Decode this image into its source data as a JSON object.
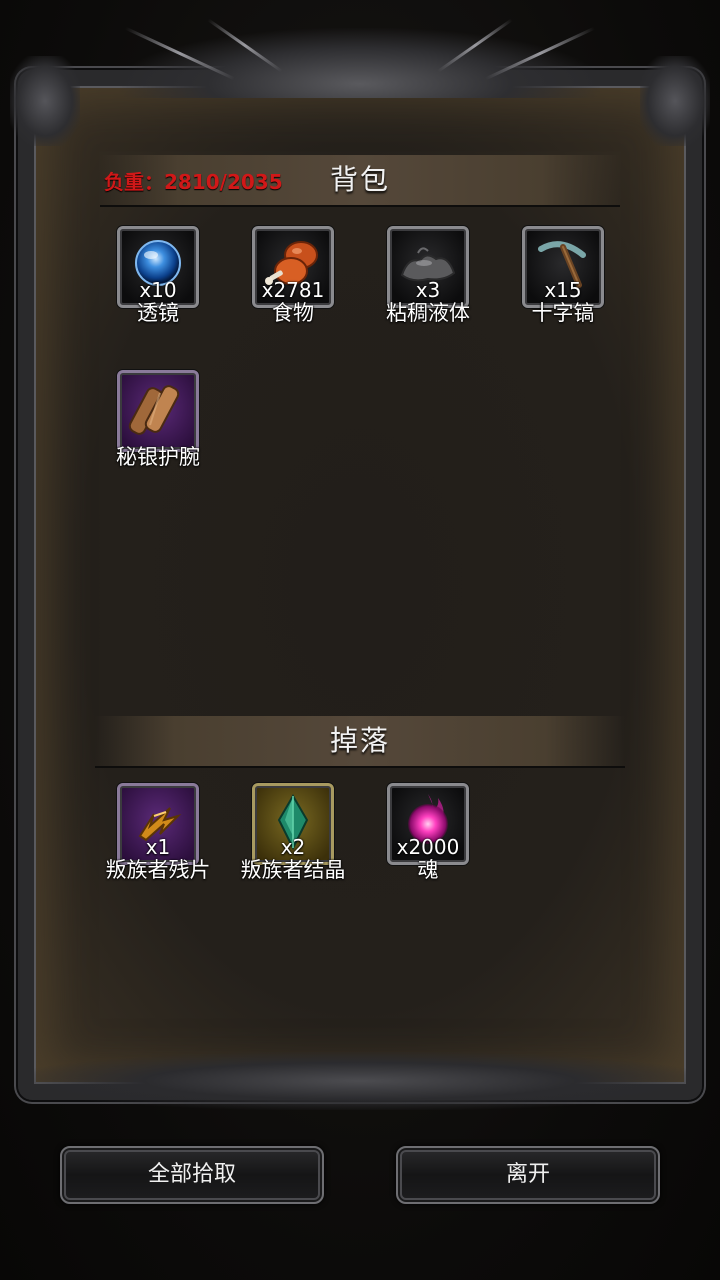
{
  "bag": {
    "title": "背包",
    "weight_label": "负重：2810/2035",
    "items": [
      {
        "name": "透镜",
        "count": "x10",
        "icon": "lens-orb-icon",
        "rarity": "normal"
      },
      {
        "name": "食物",
        "count": "x2781",
        "icon": "meat-food-icon",
        "rarity": "normal"
      },
      {
        "name": "粘稠液体",
        "count": "x3",
        "icon": "slime-liquid-icon",
        "rarity": "normal"
      },
      {
        "name": "十字镐",
        "count": "x15",
        "icon": "pickaxe-icon",
        "rarity": "normal"
      },
      {
        "name": "秘银护腕",
        "count": "",
        "icon": "mithril-bracer-icon",
        "rarity": "purple"
      }
    ]
  },
  "drops": {
    "title": "掉落",
    "items": [
      {
        "name": "叛族者残片",
        "count": "x1",
        "icon": "traitor-fragment-icon",
        "rarity": "purple"
      },
      {
        "name": "叛族者结晶",
        "count": "x2",
        "icon": "traitor-crystal-icon",
        "rarity": "gold"
      },
      {
        "name": "魂",
        "count": "x2000",
        "icon": "soul-orb-icon",
        "rarity": "normal"
      }
    ]
  },
  "buttons": {
    "pickup_all": "全部拾取",
    "leave": "离开"
  },
  "colors": {
    "weight_text": "#d01818",
    "purple_rarity": "#5b2a78",
    "gold_rarity": "#7a6a22"
  }
}
